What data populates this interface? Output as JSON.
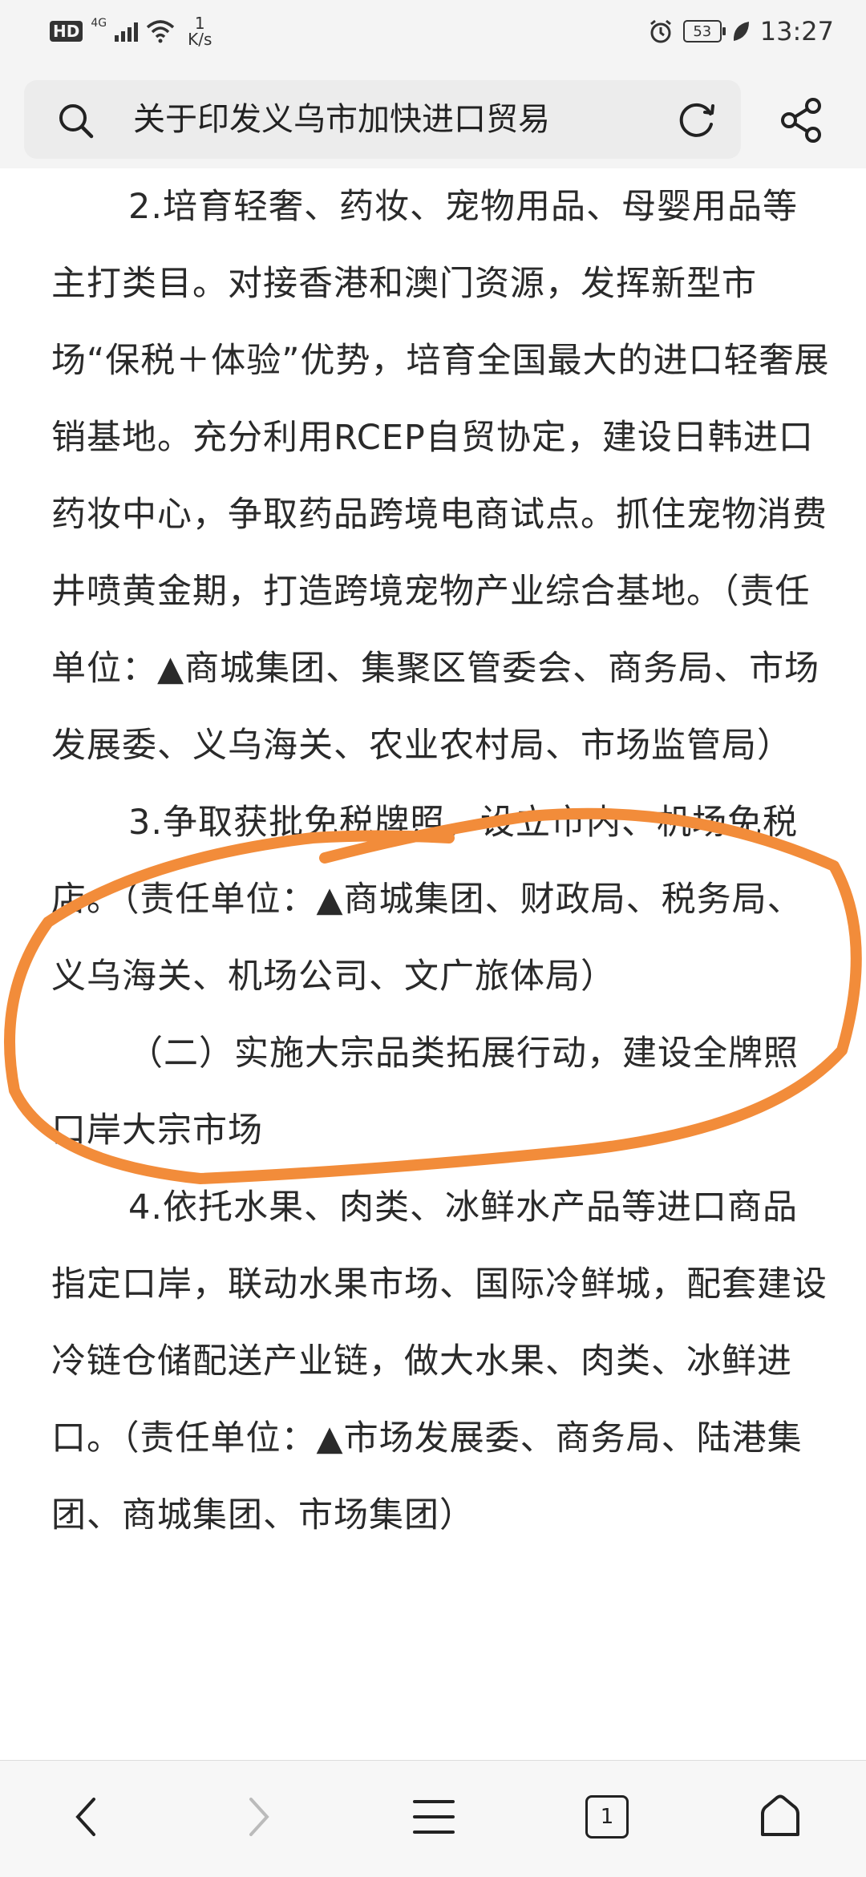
{
  "status_bar": {
    "hd": "HD",
    "network": "4G",
    "speed_value": "1",
    "speed_unit": "K/s",
    "battery_level": "53",
    "time": "13:27"
  },
  "search": {
    "query": "关于印发义乌市加快进口贸易"
  },
  "article": {
    "paragraphs": [
      "2.培育轻奢、药妆、宠物用品、母婴用品等主打类目。对接香港和澳门资源，发挥新型市场“保税＋体验”优势，培育全国最大的进口轻奢展销基地。充分利用RCEP自贸协定，建设日韩进口药妆中心，争取药品跨境电商试点。抓住宠物消费井喷黄金期，打造跨境宠物产业综合基地。（责任单位：▲商城集团、集聚区管委会、商务局、市场发展委、义乌海关、农业农村局、市场监管局）",
      "3.争取获批免税牌照，设立市内、机场免税店。（责任单位：▲商城集团、财政局、税务局、义乌海关、机场公司、文广旅体局）",
      "（二）实施大宗品类拓展行动，建设全牌照口岸大宗市场",
      "4.依托水果、肉类、冰鲜水产品等进口商品指定口岸，联动水果市场、国际冷鲜城，配套建设冷链仓储配送产业链，做大水果、肉类、冰鲜进口。（责任单位：▲市场发展委、商务局、陆港集团、商城集团、市场集团）"
    ]
  },
  "annotation": {
    "color": "#f28c3a"
  },
  "nav": {
    "tab_count": "1"
  }
}
